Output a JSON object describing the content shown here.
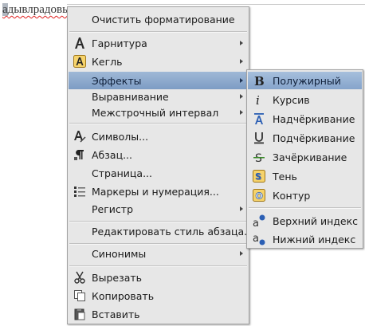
{
  "document": {
    "text": "адывлрадовыаз",
    "selected_char": "а"
  },
  "context_menu": {
    "items": [
      {
        "label": "Очистить форматирование"
      },
      {
        "label": "Гарнитура",
        "submenu": true
      },
      {
        "label": "Кегль",
        "submenu": true
      },
      {
        "label": "Эффекты",
        "submenu": true,
        "highlighted": true
      },
      {
        "label": "Выравнивание",
        "submenu": true
      },
      {
        "label": "Межстрочный интервал",
        "submenu": true
      },
      {
        "label": "Символы..."
      },
      {
        "label": "Абзац..."
      },
      {
        "label": "Страница..."
      },
      {
        "label": "Маркеры и нумерация..."
      },
      {
        "label": "Регистр",
        "submenu": true
      },
      {
        "label": "Редактировать стиль абзаца..."
      },
      {
        "label": "Синонимы",
        "submenu": true
      },
      {
        "label": "Вырезать"
      },
      {
        "label": "Копировать"
      },
      {
        "label": "Вставить"
      }
    ]
  },
  "effects_submenu": {
    "items": [
      {
        "label": "Полужирный",
        "highlighted": true
      },
      {
        "label": "Курсив"
      },
      {
        "label": "Надчёркивание"
      },
      {
        "label": "Подчёркивание"
      },
      {
        "label": "Зачёркивание"
      },
      {
        "label": "Тень"
      },
      {
        "label": "Контур"
      },
      {
        "label": "Верхний индекс"
      },
      {
        "label": "Нижний индекс"
      }
    ]
  },
  "colors": {
    "highlight": "#8aa6cc",
    "menu_bg": "#e7e7e7",
    "spell_error": "#e02020"
  }
}
